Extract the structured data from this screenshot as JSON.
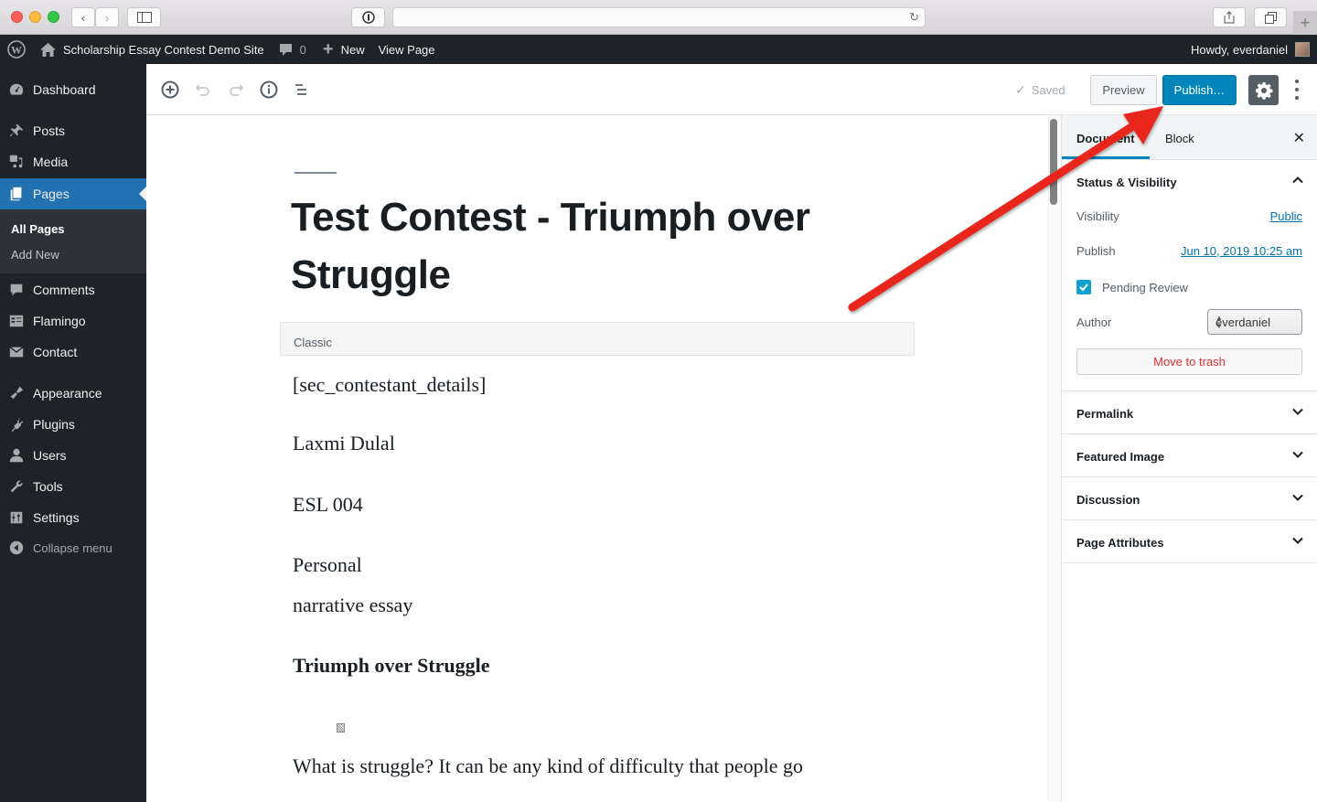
{
  "browser": {
    "url": "",
    "icons": [
      "back-icon",
      "forward-icon",
      "sidebar-icon",
      "password-icon",
      "reload-icon",
      "share-icon",
      "tabs-icon",
      "new-tab-icon"
    ]
  },
  "adminbar": {
    "site_name": "Scholarship Essay Contest Demo Site",
    "comments_count": "0",
    "new_label": "New",
    "view_page_label": "View Page",
    "howdy": "Howdy, everdaniel"
  },
  "menu": {
    "items": [
      {
        "label": "Dashboard",
        "icon": "dashboard-icon"
      },
      {
        "label": "Posts",
        "icon": "pin-icon"
      },
      {
        "label": "Media",
        "icon": "media-icon"
      },
      {
        "label": "Pages",
        "icon": "pages-icon",
        "active": true
      },
      {
        "label": "Comments",
        "icon": "comment-icon"
      },
      {
        "label": "Flamingo",
        "icon": "flamingo-icon"
      },
      {
        "label": "Contact",
        "icon": "mail-icon"
      },
      {
        "label": "Appearance",
        "icon": "brush-icon"
      },
      {
        "label": "Plugins",
        "icon": "plugin-icon"
      },
      {
        "label": "Users",
        "icon": "user-icon"
      },
      {
        "label": "Tools",
        "icon": "wrench-icon"
      },
      {
        "label": "Settings",
        "icon": "settings-sliders-icon"
      }
    ],
    "submenu": [
      {
        "label": "All Pages",
        "current": true
      },
      {
        "label": "Add New"
      }
    ],
    "collapse_label": "Collapse menu"
  },
  "toolbar": {
    "saved_label": "Saved",
    "preview_label": "Preview",
    "publish_label": "Publish…"
  },
  "post": {
    "title": "Test Contest - Triumph over Struggle",
    "classic_block_label": "Classic",
    "paragraphs": [
      "[sec_contestant_details]",
      "Laxmi Dulal",
      "ESL 004",
      "Personal",
      "narrative essay",
      "Triumph over Struggle",
      "What is struggle? It can be any kind of difficulty that people go"
    ]
  },
  "sidebar": {
    "tabs": [
      "Document",
      "Block"
    ],
    "active_tab": "Document",
    "status_panel": {
      "title": "Status & Visibility",
      "visibility_label": "Visibility",
      "visibility_value": "Public",
      "publish_label": "Publish",
      "publish_value": "Jun 10, 2019 10:25 am",
      "pending_review_label": "Pending Review",
      "pending_review_checked": true,
      "author_label": "Author",
      "author_value": "everdaniel",
      "trash_label": "Move to trash"
    },
    "panels": [
      "Permalink",
      "Featured Image",
      "Discussion",
      "Page Attributes"
    ]
  },
  "colors": {
    "wp_blue": "#0085ba",
    "admin_dark": "#1d2327",
    "menu_active": "#2271b1",
    "annotation_arrow": "#e8261b",
    "trash_red": "#dc3232"
  }
}
